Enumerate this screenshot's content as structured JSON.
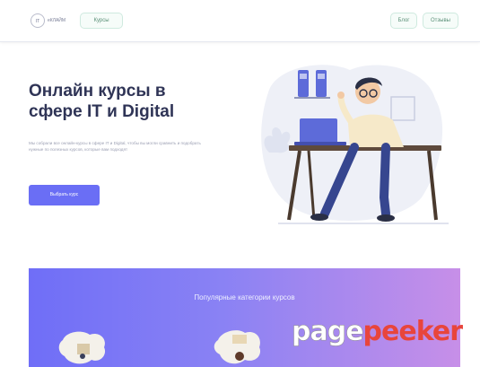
{
  "header": {
    "logo_mark": "IT",
    "logo_text": "еКЛАЙМ",
    "courses_label": "Курсы",
    "blog_label": "Блог",
    "reviews_label": "Отзывы"
  },
  "hero": {
    "title": "Онлайн курсы в сфере IT и Digital",
    "description": "Мы собрали все онлайн-курсы в сфере IT и Digital, чтобы вы могли сравнить и подобрать нужные по полезных курсов, которые вам подходят",
    "cta_label": "Выбрать курс"
  },
  "categories": {
    "title": "Популярные категории курсов"
  },
  "watermark": {
    "part1": "page",
    "part2": "peeker"
  },
  "colors": {
    "accent": "#6a6ef5",
    "gradient_start": "#6f6ef7",
    "gradient_end": "#c78fe8",
    "watermark_red": "#e8453c"
  }
}
